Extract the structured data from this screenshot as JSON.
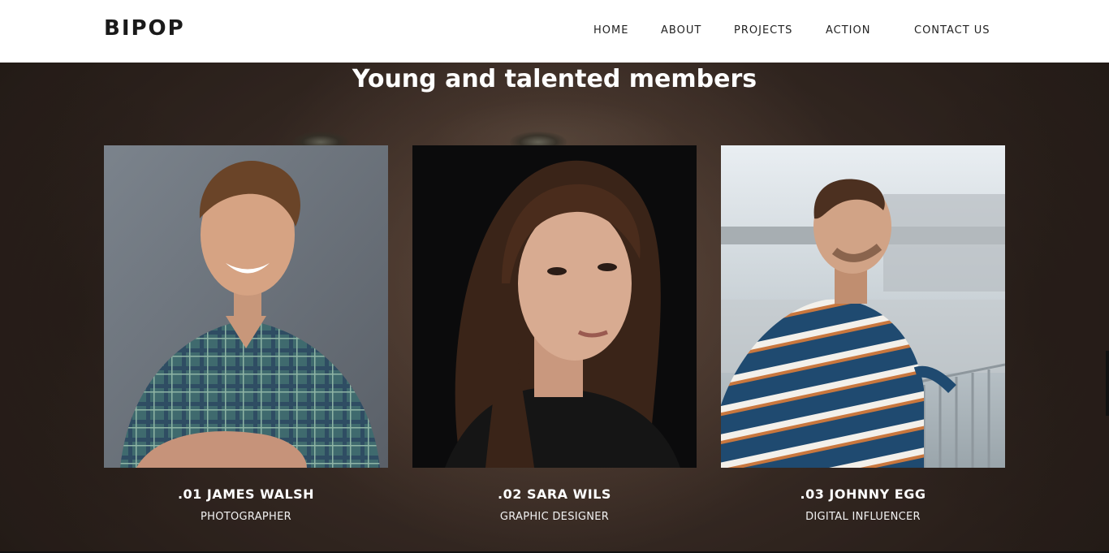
{
  "header": {
    "brand": "BIPOP",
    "nav": [
      "HOME",
      "ABOUT",
      "PROJECTS",
      "ACTION",
      "CONTACT US"
    ]
  },
  "section": {
    "title": "Young and talented members"
  },
  "members": [
    {
      "name": ".01 JAMES WALSH",
      "role": "PHOTOGRAPHER"
    },
    {
      "name": ".02 SARA WILS",
      "role": "GRAPHIC DESIGNER"
    },
    {
      "name": ".03 JOHNNY EGG",
      "role": "DIGITAL INFLUENCER"
    }
  ],
  "colors": {
    "header_bg": "#ffffff",
    "heading_text": "#ffffff",
    "hero_bg": "#3b2e28"
  }
}
